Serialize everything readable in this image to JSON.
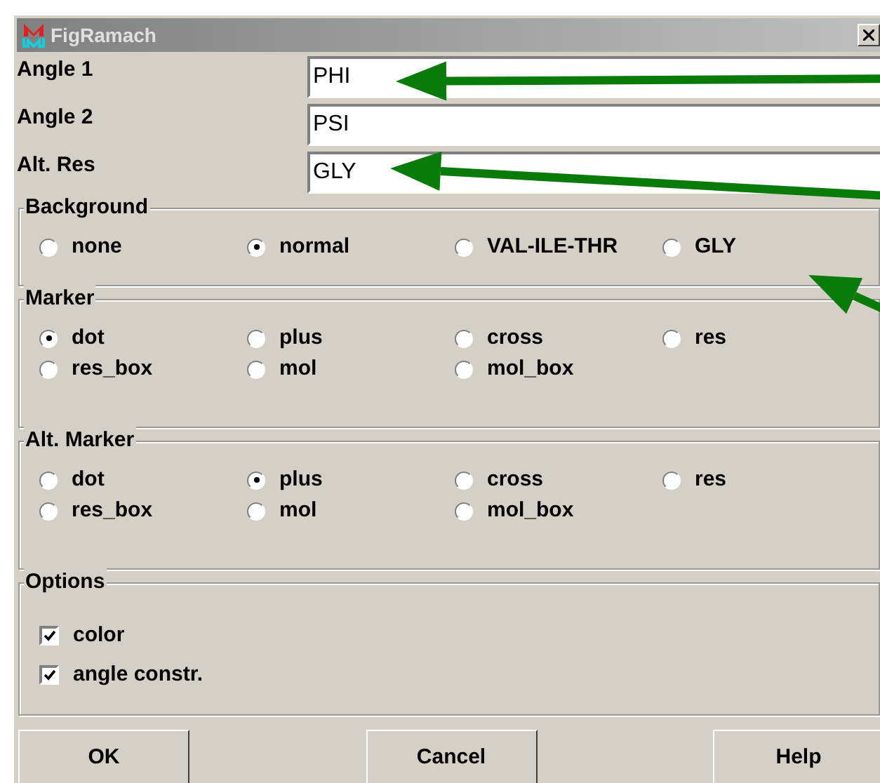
{
  "window": {
    "title": "FigRamach"
  },
  "fields": [
    {
      "label": "Angle 1",
      "value": "PHI"
    },
    {
      "label": "Angle 2",
      "value": "PSI"
    },
    {
      "label": "Alt. Res",
      "value": "GLY"
    }
  ],
  "radio_groups": [
    {
      "title": "Background",
      "options": [
        {
          "label": "none",
          "selected": false
        },
        {
          "label": "normal",
          "selected": true
        },
        {
          "label": "VAL-ILE-THR",
          "selected": false
        },
        {
          "label": "GLY",
          "selected": false
        }
      ]
    },
    {
      "title": "Marker",
      "options": [
        {
          "label": "dot",
          "selected": true
        },
        {
          "label": "plus",
          "selected": false
        },
        {
          "label": "cross",
          "selected": false
        },
        {
          "label": "res",
          "selected": false
        },
        {
          "label": "res_box",
          "selected": false
        },
        {
          "label": "mol",
          "selected": false
        },
        {
          "label": "mol_box",
          "selected": false
        }
      ]
    },
    {
      "title": "Alt. Marker",
      "options": [
        {
          "label": "dot",
          "selected": false
        },
        {
          "label": "plus",
          "selected": true
        },
        {
          "label": "cross",
          "selected": false
        },
        {
          "label": "res",
          "selected": false
        },
        {
          "label": "res_box",
          "selected": false
        },
        {
          "label": "mol",
          "selected": false
        },
        {
          "label": "mol_box",
          "selected": false
        }
      ]
    }
  ],
  "options": {
    "title": "Options",
    "checkboxes": [
      {
        "label": "color",
        "checked": true
      },
      {
        "label": "angle constr.",
        "checked": true
      }
    ]
  },
  "buttons": [
    "OK",
    "Cancel",
    "Help"
  ]
}
